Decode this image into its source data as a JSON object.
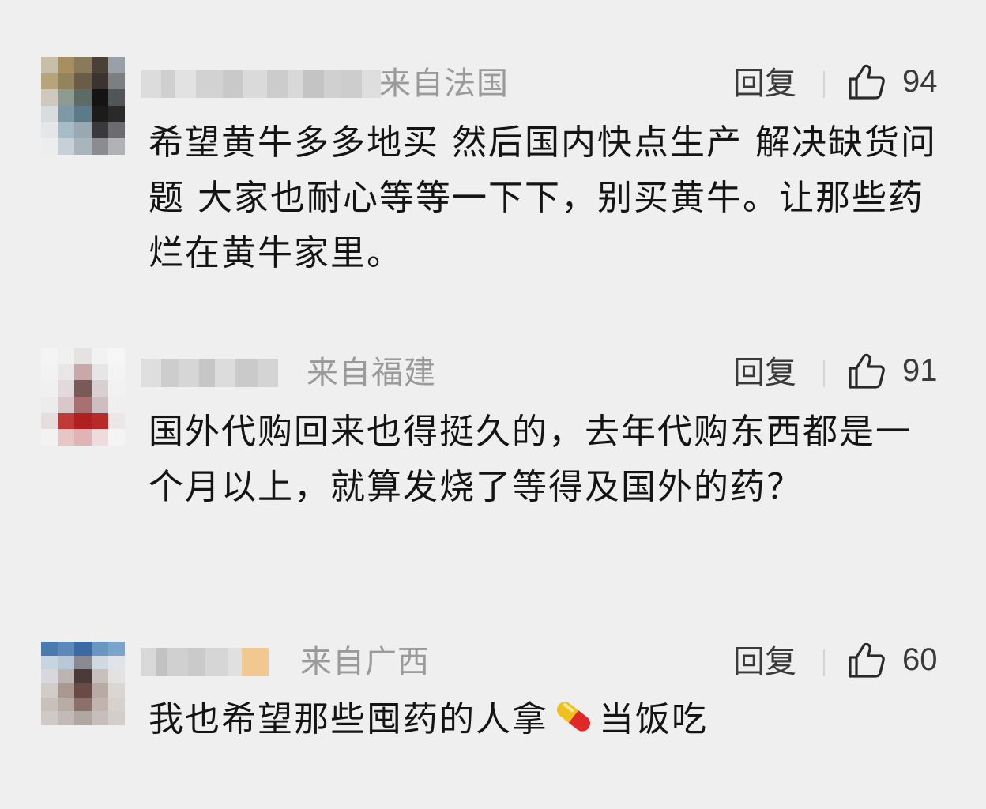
{
  "comments": [
    {
      "location": "来自法国",
      "reply_label": "回复",
      "like_count": "94",
      "text": "希望黄牛多多地买 然后国内快点生产 解决缺货问题 大家也耐心等等一下下，别买黄牛。让那些药烂在黄牛家里。",
      "username_blurred": true,
      "avatar_blurred": true
    },
    {
      "location": "来自福建",
      "reply_label": "回复",
      "like_count": "91",
      "text": "国外代购回来也得挺久的，去年代购东西都是一个月以上，就算发烧了等得及国外的药？",
      "username_blurred": true,
      "avatar_blurred": true
    },
    {
      "location": "来自广西",
      "reply_label": "回复",
      "like_count": "60",
      "text_before_emoji": "我也希望那些囤药的人拿",
      "emoji": "pill-emoji",
      "text_after_emoji": "当饭吃",
      "username_blurred": true,
      "avatar_blurred": true
    }
  ],
  "colors": {
    "background": "#efefef",
    "body_text": "#141414",
    "meta_text": "#9a9a9a",
    "action_text": "#3a3a3a"
  },
  "icons": {
    "like": "thumbs-up-icon"
  }
}
